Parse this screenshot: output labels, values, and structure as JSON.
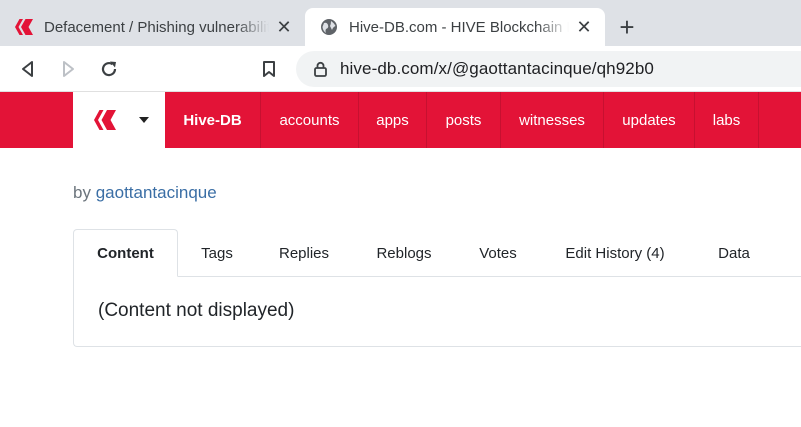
{
  "browser": {
    "tabs": [
      {
        "title": "Defacement / Phishing vulnerability",
        "favicon": "hive-logo-icon",
        "active": false
      },
      {
        "title": "Hive-DB.com - HIVE Blockchain Explorer",
        "favicon": "globe-icon",
        "active": true
      }
    ],
    "new_tab_label": "+",
    "close_label": "✕",
    "url": "hive-db.com/x/@gaottantacinque/qh92b0"
  },
  "site_nav": {
    "brand_color": "#e31337",
    "items": [
      {
        "label": "Hive-DB"
      },
      {
        "label": "accounts"
      },
      {
        "label": "apps"
      },
      {
        "label": "posts"
      },
      {
        "label": "witnesses"
      },
      {
        "label": "updates"
      },
      {
        "label": "labs"
      }
    ]
  },
  "post": {
    "by_prefix": "by",
    "author": "gaottantacinque",
    "tabs": [
      {
        "label": "Content"
      },
      {
        "label": "Tags"
      },
      {
        "label": "Replies"
      },
      {
        "label": "Reblogs"
      },
      {
        "label": "Votes"
      },
      {
        "label": "Edit History (4)"
      },
      {
        "label": "Data"
      }
    ],
    "active_tab": "Content",
    "content_message": "(Content not displayed)"
  }
}
